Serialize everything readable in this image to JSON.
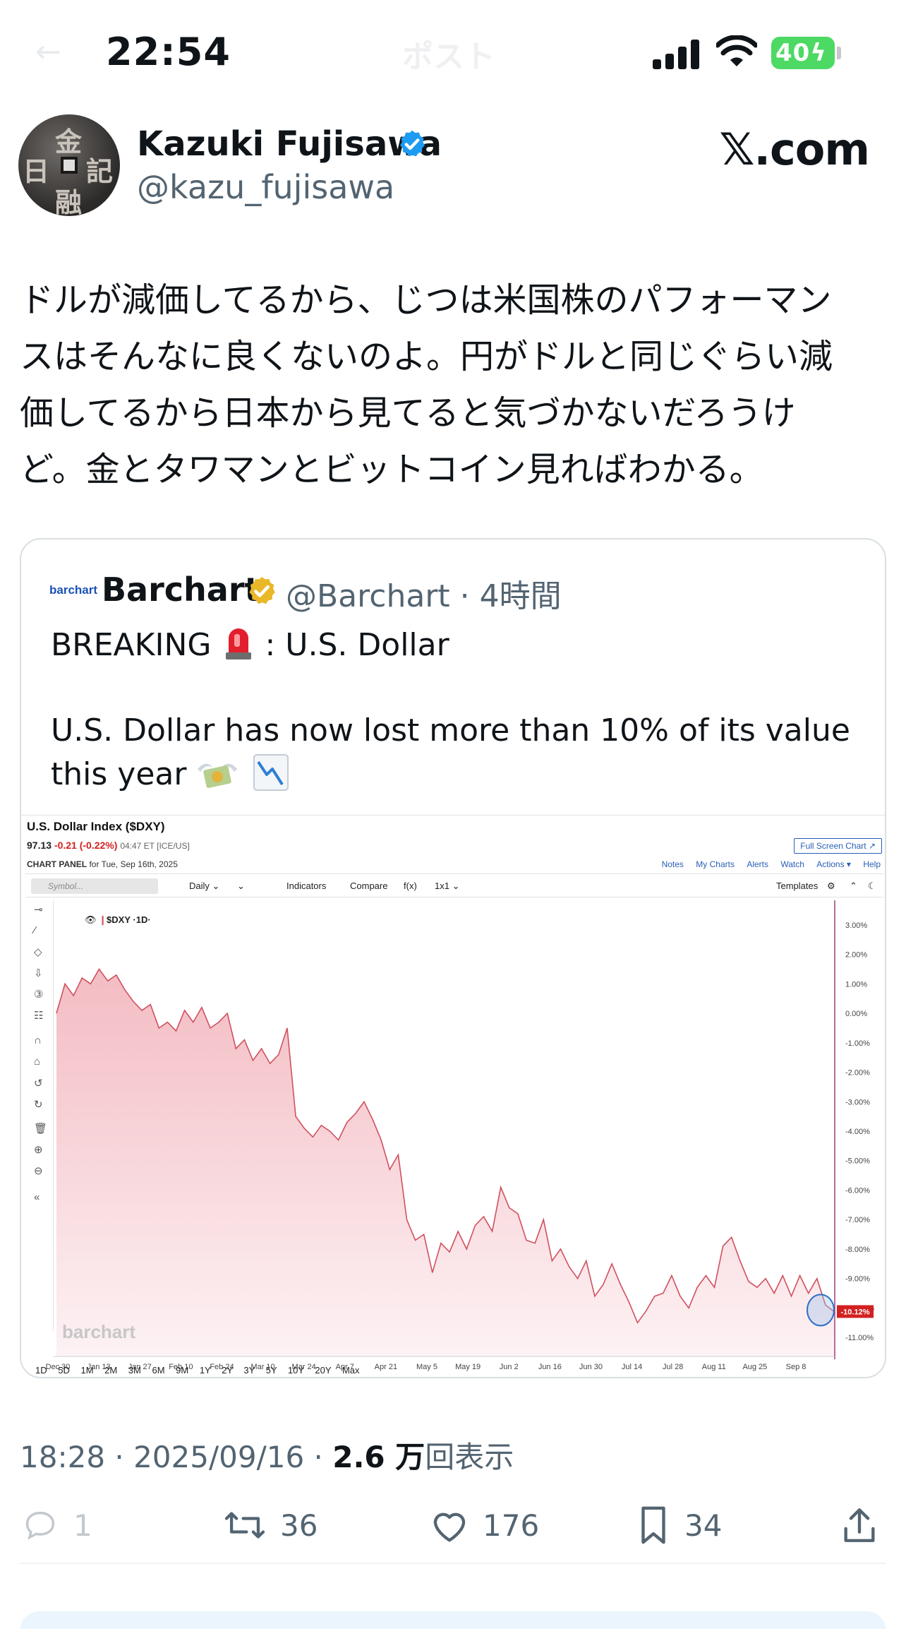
{
  "status_bar": {
    "time": "22:54",
    "battery": "40",
    "ghost_title": "ポスト"
  },
  "author": {
    "name": "Kazuki Fujisawa",
    "handle": "@kazu_fujisawa",
    "avatar_glyphs": [
      "金",
      "記",
      "日",
      "融"
    ]
  },
  "watermark": "𝕏.com",
  "tweet_lines": [
    "ドルが減価してるから、じつは米国株のパフォーマン",
    "スはそんなに良くないのよ。円がドルと同じぐらい減",
    "価してるから日本から見てると気づかないだろうけ",
    "ど。金とタワマンとビットコイン見ればわかる。"
  ],
  "quote": {
    "logo_text": "barchart",
    "name": "Barchart",
    "handle": "@Barchart · 4時間",
    "line1_prefix": "BREAKING",
    "line1_suffix": ": U.S. Dollar",
    "body_lines": [
      "U.S. Dollar has now lost more than 10% of its value",
      "this year"
    ]
  },
  "chart_screenshot": {
    "title": "U.S. Dollar Index ($DXY)",
    "price": "97.13",
    "change": "-0.21 (-0.22%)",
    "time_meta": "04:47 ET [ICE/US]",
    "fullscreen_label": "Full Screen Chart ↗",
    "panel_label": "CHART PANEL",
    "panel_date": "for Tue, Sep 16th, 2025",
    "links": [
      "Notes",
      "My Charts",
      "Alerts",
      "Watch",
      "Actions ▾",
      "Help"
    ],
    "symbol_placeholder": "Symbol...",
    "toolbar": [
      "Daily ⌄",
      "⌄",
      "Indicators",
      "Compare",
      "f(x)",
      "1x1 ⌄",
      "Templates"
    ],
    "series_label": "$DXY ·1D·",
    "watermark": "barchart",
    "ranges": "1D 5D 1M 2M 3M 6M 9M 1Y 2Y 3Y 5Y 10Y 20Y Max",
    "accent_color": "#d0505e",
    "last_label": "-10.12%"
  },
  "chart_data": {
    "type": "area",
    "title": "U.S. Dollar Index ($DXY)",
    "ylabel": "",
    "xlabel": "",
    "ylim": [
      -11.5,
      3.5
    ],
    "y_ticks": [
      "3.00%",
      "2.00%",
      "1.00%",
      "0.00%",
      "-1.00%",
      "-2.00%",
      "-3.00%",
      "-4.00%",
      "-5.00%",
      "-6.00%",
      "-7.00%",
      "-8.00%",
      "-9.00%",
      "-10.00%",
      "-11.00%"
    ],
    "x_ticks": [
      "Dec 30",
      "Jan 13",
      "Jan 27",
      "Feb 10",
      "Feb 24",
      "Mar 10",
      "Mar 24",
      "Apr 7",
      "Apr 21",
      "May 5",
      "May 19",
      "Jun 2",
      "Jun 16",
      "Jun 30",
      "Jul 14",
      "Jul 28",
      "Aug 11",
      "Aug 25",
      "Sep 8"
    ],
    "series": [
      {
        "values": [
          0.0,
          1.0,
          0.6,
          1.2,
          1.0,
          1.5,
          1.1,
          1.3,
          0.8,
          0.4,
          0.1,
          0.3,
          -0.5,
          -0.3,
          -0.6,
          0.1,
          -0.3,
          0.2,
          -0.5,
          -0.3,
          0.0,
          -1.2,
          -0.9,
          -1.6,
          -1.2,
          -1.7,
          -1.4,
          -0.5,
          -3.5,
          -3.9,
          -4.2,
          -3.8,
          -4.0,
          -4.3,
          -3.7,
          -3.4,
          -3.0,
          -3.6,
          -4.3,
          -5.3,
          -4.8,
          -7.0,
          -7.7,
          -7.5,
          -8.8,
          -7.8,
          -8.1,
          -7.4,
          -8.0,
          -7.2,
          -6.9,
          -7.4,
          -5.9,
          -6.6,
          -6.8,
          -7.7,
          -7.8,
          -7.0,
          -8.4,
          -8.0,
          -8.6,
          -9.0,
          -8.4,
          -9.6,
          -9.2,
          -8.5,
          -9.2,
          -9.8,
          -10.5,
          -10.1,
          -9.6,
          -9.5,
          -8.9,
          -9.6,
          -10.0,
          -9.3,
          -8.9,
          -9.3,
          -7.9,
          -7.6,
          -8.4,
          -9.1,
          -9.3,
          -9.0,
          -9.5,
          -8.9,
          -9.6,
          -8.9,
          -9.5,
          -9.0,
          -9.9,
          -10.12
        ]
      }
    ],
    "grid": false,
    "legend": "none"
  },
  "footer": {
    "time": "18:28 · 2025/09/16 · ",
    "views_count": "2.6 万",
    "views_label": "回表示"
  },
  "actions": {
    "replies": "1",
    "reposts": "36",
    "likes": "176",
    "bookmarks": "34"
  }
}
